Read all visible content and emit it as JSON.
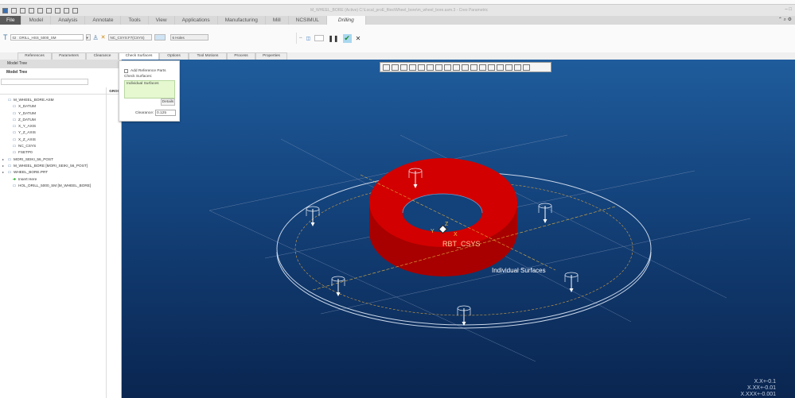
{
  "window": {
    "title": "M_WHEEL_BORE (Active) C:\\Local_proE_files\\Wheel_bore\\m_wheel_bore.asm.3 - Creo Parametric"
  },
  "menu": {
    "tabs": [
      "File",
      "Model",
      "Analysis",
      "Annotate",
      "Tools",
      "View",
      "Applications",
      "Manufacturing",
      "Mill",
      "NCSIMUL",
      "Drilling"
    ],
    "active": "Drilling"
  },
  "ribbon": {
    "tool": "02 : DRILL_HSS_5000_SM",
    "csys": "NC_CSYS:F7(CSYS)",
    "holes": "6 Holes"
  },
  "subtabs": [
    "References",
    "Parameters",
    "Clearance",
    "Check Surfaces",
    "Options",
    "Tool Motions",
    "Process",
    "Properties"
  ],
  "check_surfaces_panel": {
    "add_reference_parts": "Add Reference Parts",
    "check_surfaces_label": "Check Surfaces:",
    "selection": "Individual Surfaces",
    "details_button": "Details",
    "clearance_label": "Clearance:",
    "clearance_value": "0.125"
  },
  "model_tree": {
    "tab": "Model Tree",
    "header": "Model Tree",
    "column": "GROO",
    "items": [
      {
        "label": "M_WHEEL_BORE.ASM",
        "icon": "assembly-icon"
      },
      {
        "label": "X_DATUM",
        "icon": "datum-plane-icon"
      },
      {
        "label": "Y_DATUM",
        "icon": "datum-plane-icon"
      },
      {
        "label": "Z_DATUM",
        "icon": "datum-plane-icon"
      },
      {
        "label": "X_Y_AXIS",
        "icon": "axis-icon"
      },
      {
        "label": "Y_Z_AXIS",
        "icon": "axis-icon"
      },
      {
        "label": "X_Z_AXIS",
        "icon": "axis-icon"
      },
      {
        "label": "NC_CSYS",
        "icon": "csys-icon"
      },
      {
        "label": "FSETP0",
        "icon": "fixture-icon"
      },
      {
        "label": "MORI_SEIKI_56_POST",
        "icon": "workcell-icon",
        "expand": true
      },
      {
        "label": "M_WHEEL_BORE [MORI_SEIKI_56_POST]",
        "icon": "operation-icon",
        "expand": true
      },
      {
        "label": "WHEEL_BORE.PRT",
        "icon": "part-icon",
        "expand": true
      },
      {
        "label": "Insert Here",
        "icon": "insert-icon"
      },
      {
        "label": "HOL_DRILL_5000_SM [M_WHEEL_BORE]",
        "icon": "drill-sequence-icon"
      }
    ]
  },
  "viewport": {
    "csys_label": "RBT_CSYS",
    "axis_x": "X",
    "axis_y": "Y",
    "axis_z": "Z",
    "surface_label": "Individual Surfaces",
    "tolerances": [
      "X.X+-0.1",
      "X.XX+-0.01",
      "X.XXX+-0.001"
    ]
  },
  "colors": {
    "part": "#cc0000",
    "background": "#134179",
    "accent": "#a9d8f0"
  }
}
